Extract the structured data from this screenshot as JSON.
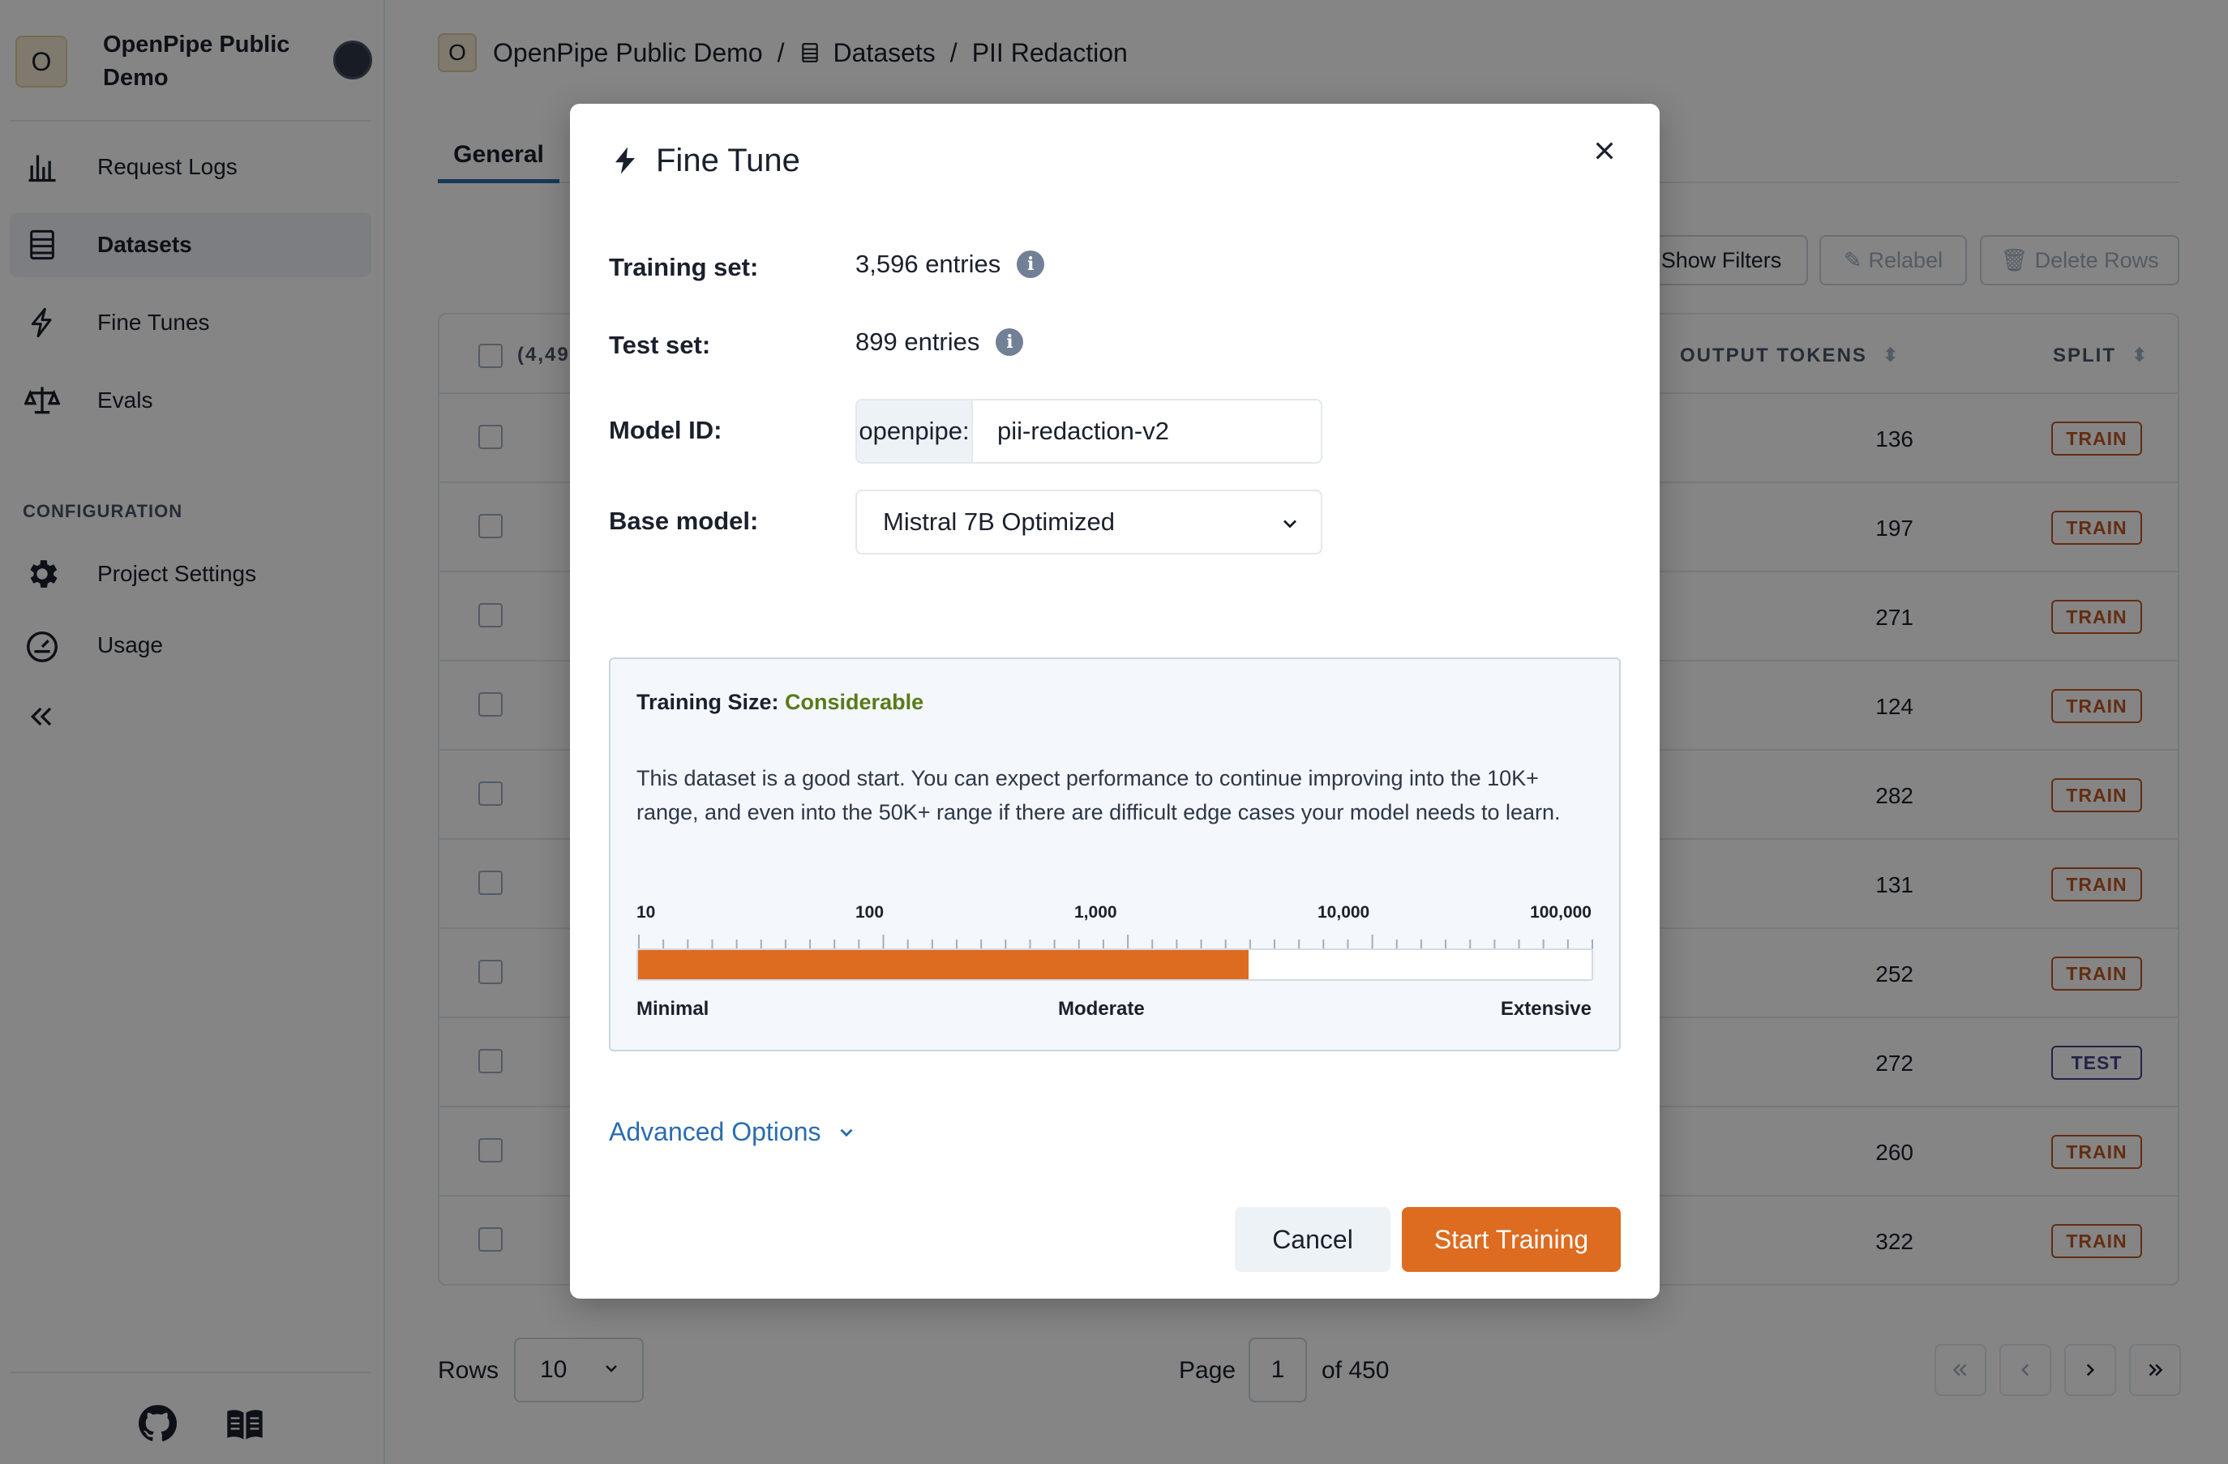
{
  "project": {
    "badge": "O",
    "name": "OpenPipe Public Demo"
  },
  "sidebar": {
    "items": [
      {
        "label": "Request Logs",
        "icon": "bar-chart-icon"
      },
      {
        "label": "Datasets",
        "icon": "table-icon",
        "active": true
      },
      {
        "label": "Fine Tunes",
        "icon": "lightning-icon"
      },
      {
        "label": "Evals",
        "icon": "scale-icon"
      }
    ],
    "config_label": "CONFIGURATION",
    "config_items": [
      {
        "label": "Project Settings",
        "icon": "gear-icon"
      },
      {
        "label": "Usage",
        "icon": "gauge-icon"
      }
    ]
  },
  "breadcrumb": {
    "badge": "O",
    "project": "OpenPipe Public Demo",
    "sep": "/",
    "section": "Datasets",
    "page": "PII Redaction"
  },
  "tabs": {
    "general": "General"
  },
  "toolbar": {
    "show_filters": "Show Filters",
    "relabel": "Relabel",
    "delete_rows": "Delete Rows"
  },
  "table": {
    "select_count": "(4,49",
    "col_output_tokens": "OUTPUT TOKENS",
    "col_split": "SPLIT",
    "rows": [
      {
        "tokens": "136",
        "split": "TRAIN"
      },
      {
        "tokens": "197",
        "split": "TRAIN"
      },
      {
        "tokens": "271",
        "split": "TRAIN"
      },
      {
        "tokens": "124",
        "split": "TRAIN"
      },
      {
        "tokens": "282",
        "split": "TRAIN"
      },
      {
        "tokens": "131",
        "split": "TRAIN"
      },
      {
        "tokens": "252",
        "split": "TRAIN"
      },
      {
        "tokens": "272",
        "split": "TEST"
      },
      {
        "tokens": "260",
        "split": "TRAIN"
      },
      {
        "tokens": "322",
        "split": "TRAIN"
      }
    ]
  },
  "pagination": {
    "rows_label": "Rows",
    "rows_value": "10",
    "page_label": "Page",
    "page_value": "1",
    "of_label": "of 450"
  },
  "modal": {
    "title": "Fine Tune",
    "training_label": "Training set:",
    "training_value": "3,596 entries",
    "test_label": "Test set:",
    "test_value": "899 entries",
    "model_id_label": "Model ID:",
    "model_id_prefix": "openpipe:",
    "model_id_value": "pii-redaction-v2",
    "base_model_label": "Base model:",
    "base_model_value": "Mistral 7B Optimized",
    "size_title": "Training Size:",
    "size_rating": "Considerable",
    "size_description": "This dataset is a good start. You can expect performance to continue improving into the 10K+ range, and even into the 50K+ range if there are difficult edge cases your model needs to learn.",
    "scale_labels": [
      "10",
      "100",
      "1,000",
      "10,000",
      "100,000"
    ],
    "bar_labels": [
      "Minimal",
      "Moderate",
      "Extensive"
    ],
    "bar_fill_fraction": 0.64,
    "advanced": "Advanced Options",
    "cancel": "Cancel",
    "start": "Start Training"
  },
  "colors": {
    "accent": "#dd6b20",
    "link": "#2b6cb0",
    "good": "#5a7a1a"
  }
}
